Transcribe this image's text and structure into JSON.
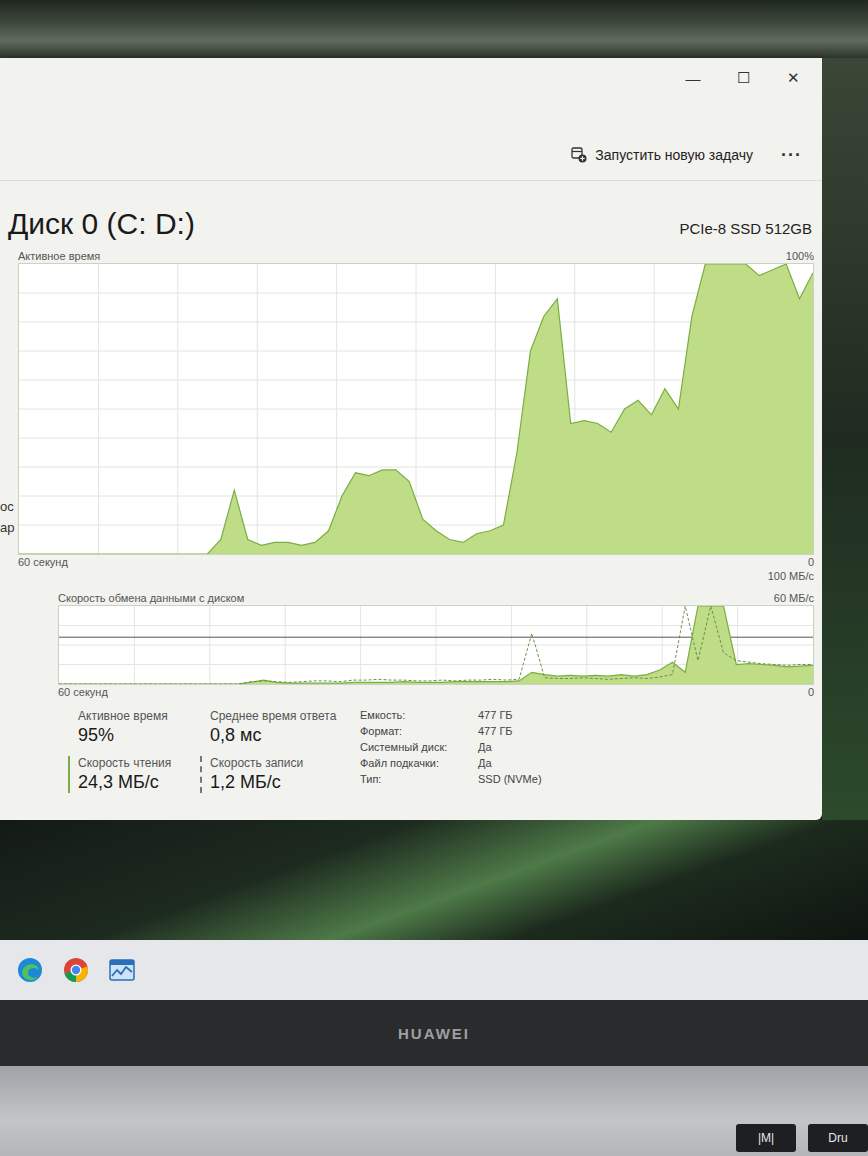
{
  "window": {
    "controls": [
      "—",
      "☐",
      "✕"
    ]
  },
  "toolbar": {
    "new_task": "Запустить новую задачу",
    "more": "···"
  },
  "sidebar": {
    "items": [
      "ос",
      "ар"
    ]
  },
  "disk": {
    "title": "Диск 0 (C: D:)",
    "model": "PCIe-8 SSD 512GB"
  },
  "active_chart": {
    "title": "Активное время",
    "max": "100%",
    "min": "0",
    "span": "60 секунд",
    "values": [
      0,
      0,
      0,
      0,
      0,
      0,
      0,
      0,
      0,
      0,
      0,
      0,
      0,
      0,
      0,
      5,
      22,
      5,
      3,
      4,
      4,
      3,
      4,
      8,
      20,
      28,
      27,
      29,
      29,
      25,
      12,
      8,
      5,
      4,
      7,
      8,
      10,
      35,
      70,
      82,
      88,
      45,
      46,
      45,
      42,
      50,
      53,
      48,
      57,
      50,
      82,
      100,
      100,
      100,
      100,
      96,
      98,
      100,
      88,
      97
    ]
  },
  "transfer_chart": {
    "title": "Скорость обмена данными с диском",
    "max": "100 МБ/с",
    "mid": "60 МБ/с",
    "min": "0",
    "span": "60 секунд",
    "read": [
      0,
      0,
      0,
      0,
      0,
      0,
      0,
      0,
      0,
      0,
      0,
      0,
      0,
      0,
      0,
      2,
      5,
      2,
      1,
      1,
      1,
      1,
      1,
      2,
      2,
      2,
      2,
      3,
      2,
      2,
      2,
      3,
      3,
      3,
      3,
      3,
      4,
      15,
      12,
      10,
      11,
      10,
      11,
      10,
      12,
      10,
      12,
      18,
      28,
      15,
      100,
      100,
      100,
      25,
      26,
      25,
      24,
      22,
      23,
      24
    ],
    "write": [
      0,
      0,
      0,
      0,
      0,
      0,
      0,
      0,
      0,
      0,
      0,
      0,
      0,
      0,
      0,
      3,
      4,
      3,
      2,
      3,
      4,
      4,
      3,
      5,
      5,
      6,
      5,
      5,
      4,
      4,
      5,
      4,
      5,
      5,
      6,
      5,
      6,
      65,
      8,
      7,
      7,
      8,
      7,
      6,
      7,
      8,
      7,
      9,
      12,
      100,
      30,
      100,
      40,
      30,
      28,
      26,
      25,
      24,
      25,
      25
    ]
  },
  "stats": [
    {
      "label": "Активное время",
      "value": "95%",
      "kind": "plain"
    },
    {
      "label": "Среднее время ответа",
      "value": "0,8 мс",
      "kind": "plain"
    },
    {
      "label": "Скорость чтения",
      "value": "24,3 МБ/с",
      "kind": "read"
    },
    {
      "label": "Скорость записи",
      "value": "1,2 МБ/с",
      "kind": "write"
    }
  ],
  "properties": [
    {
      "label": "Емкость:",
      "value": "477 ГБ"
    },
    {
      "label": "Формат:",
      "value": "477 ГБ"
    },
    {
      "label": "Системный диск:",
      "value": "Да"
    },
    {
      "label": "Файл подкачки:",
      "value": "Да"
    },
    {
      "label": "Тип:",
      "value": "SSD (NVMe)"
    }
  ],
  "laptop": {
    "brand": "HUAWEI"
  },
  "keyboard": {
    "keys": [
      "|M|",
      "Dru"
    ]
  }
}
